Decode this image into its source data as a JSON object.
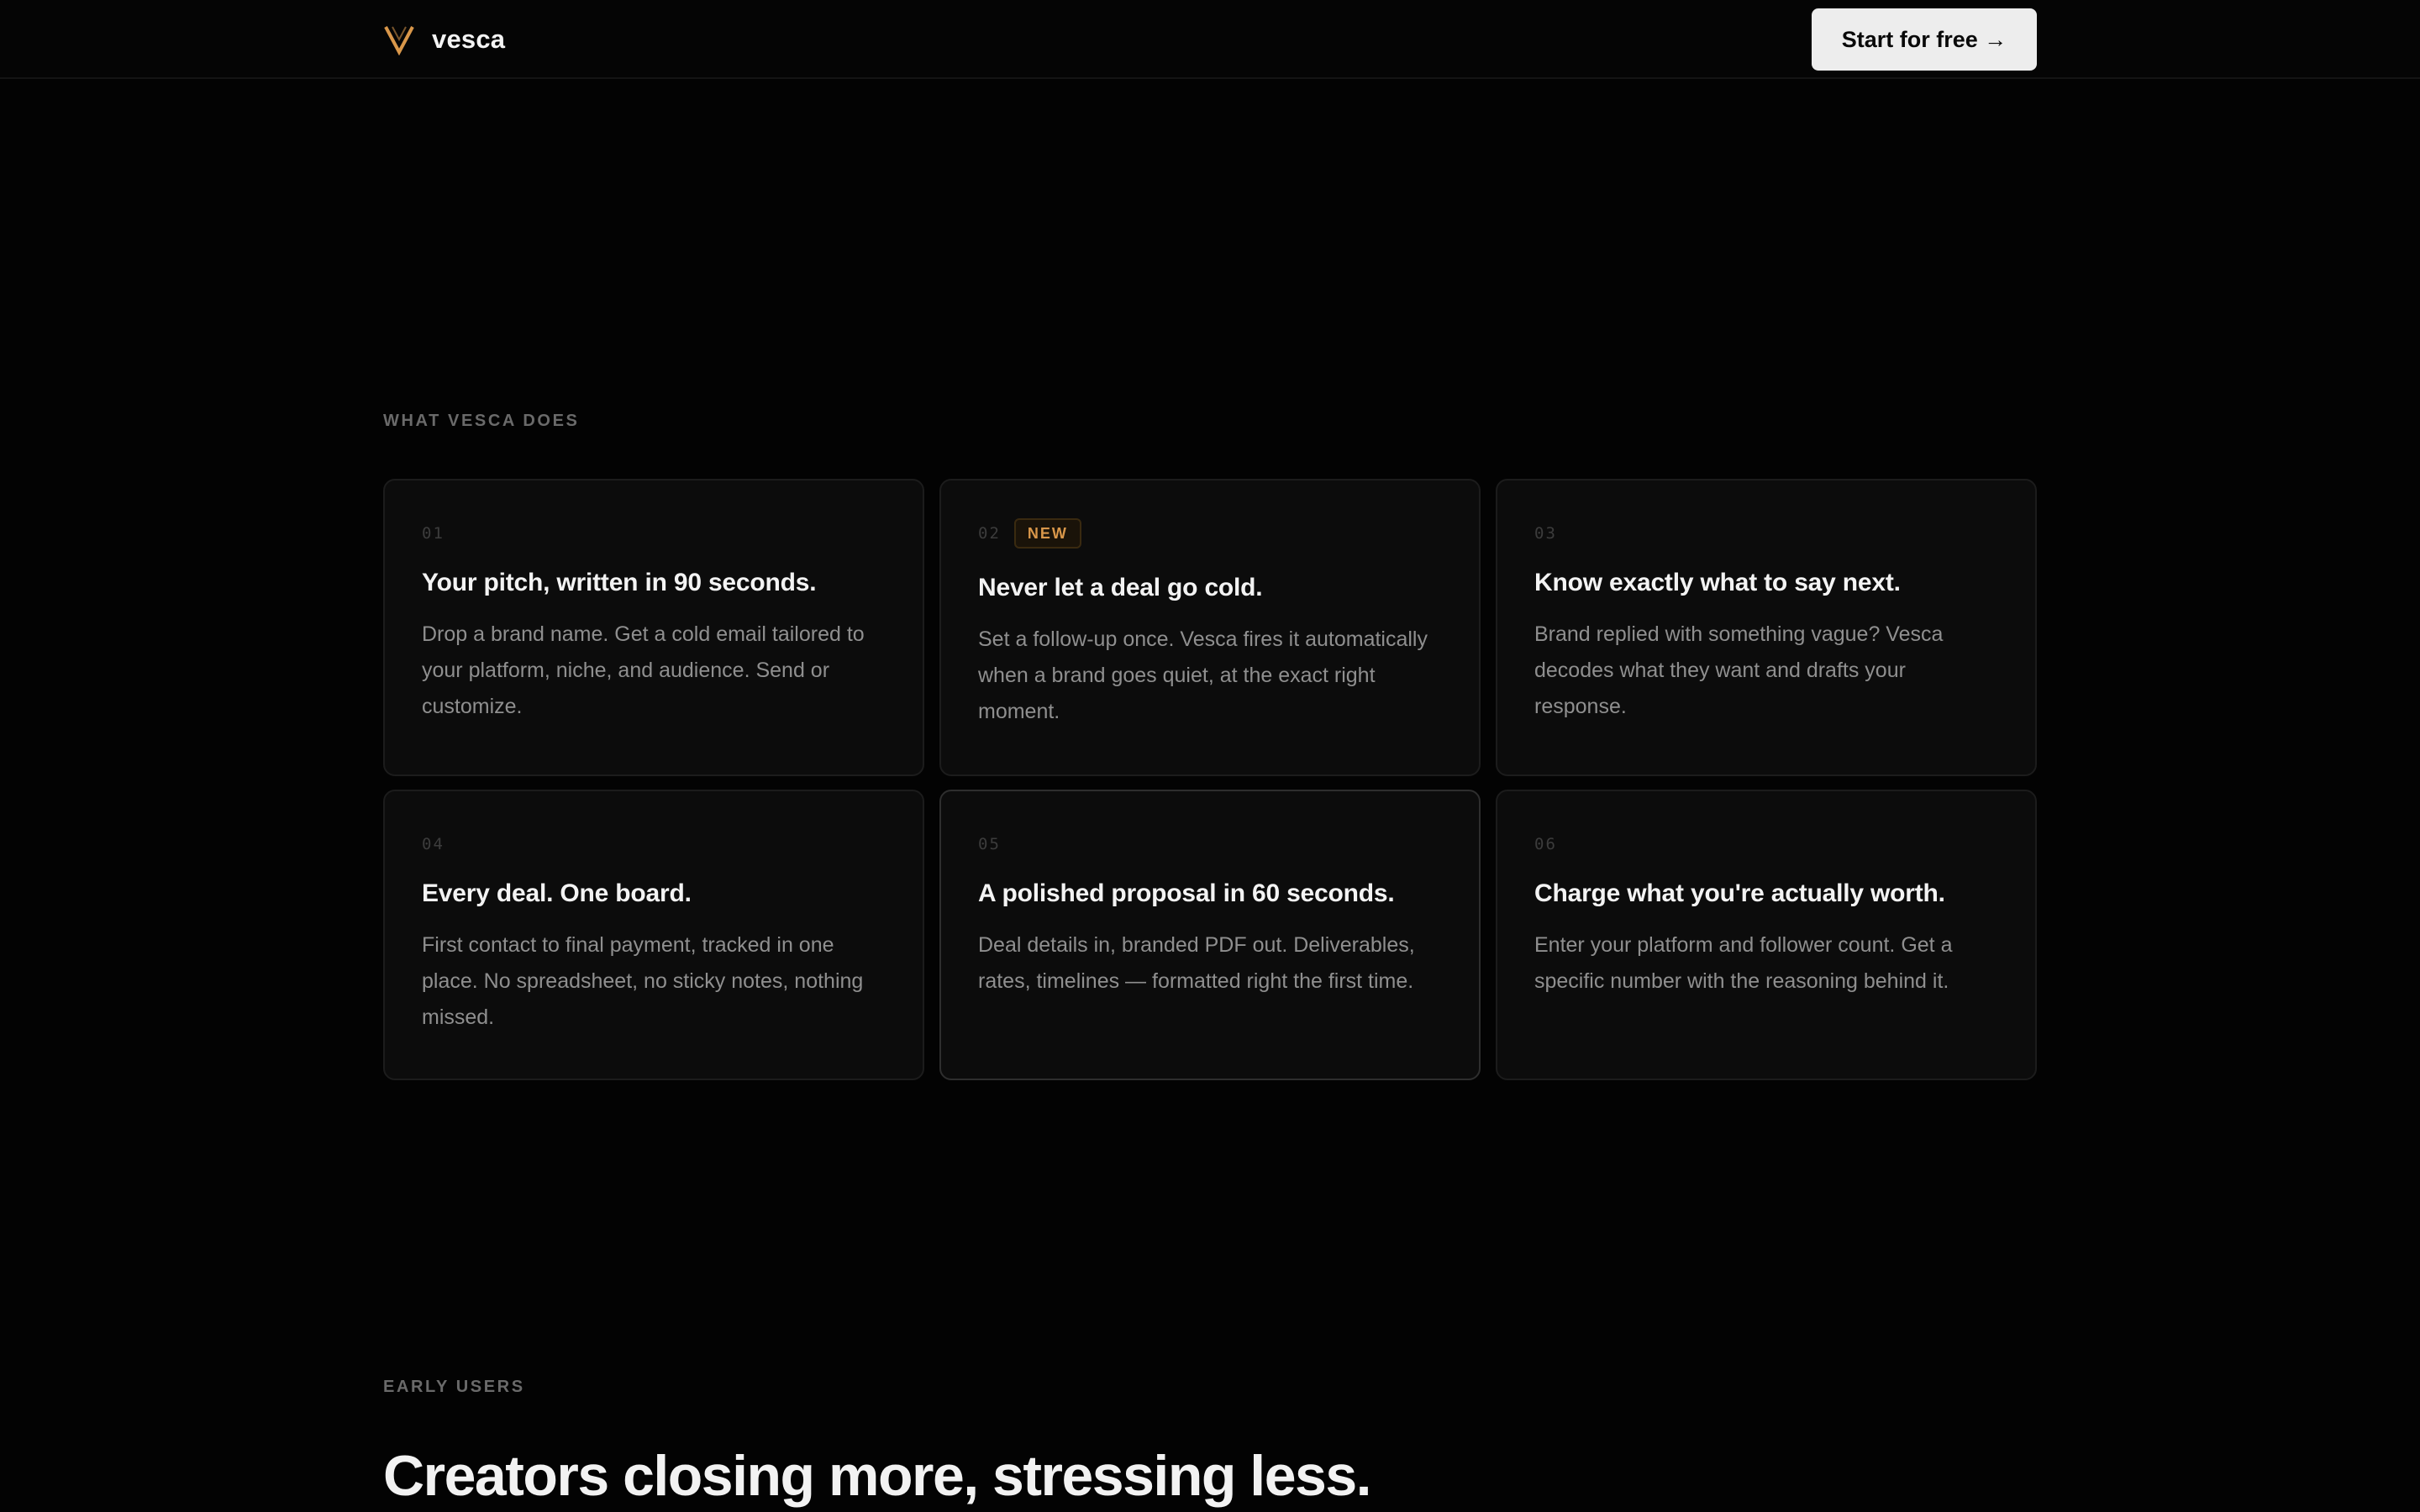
{
  "header": {
    "brand_name": "vesca",
    "logo_icon": "v-chevron-logo-icon",
    "cta_label": "Start for free →"
  },
  "colors": {
    "background": "#030303",
    "accent": "#d9974a",
    "card_background": "#0c0c0c",
    "cta_background": "#ededed"
  },
  "features": {
    "section_label": "WHAT VESCA DOES",
    "cards": [
      {
        "number": "01",
        "title": "Your pitch, written in 90 seconds.",
        "description": "Drop a brand name. Get a cold email tailored to your platform, niche, and audience. Send or customize."
      },
      {
        "number": "02",
        "badge": "NEW",
        "title": "Never let a deal go cold.",
        "description": "Set a follow-up once. Vesca fires it automatically when a brand goes quiet, at the exact right moment."
      },
      {
        "number": "03",
        "title": "Know exactly what to say next.",
        "description": "Brand replied with something vague? Vesca decodes what they want and drafts your response."
      },
      {
        "number": "04",
        "title": "Every deal. One board.",
        "description": "First contact to final payment, tracked in one place. No spreadsheet, no sticky notes, nothing missed."
      },
      {
        "number": "05",
        "title": "A polished proposal in 60 seconds.",
        "description": "Deal details in, branded PDF out. Deliverables, rates, timelines — formatted right the first time."
      },
      {
        "number": "06",
        "title": "Charge what you're actually worth.",
        "description": "Enter your platform and follower count. Get a specific number with the reasoning behind it."
      }
    ]
  },
  "early_users": {
    "section_label": "EARLY USERS",
    "heading": "Creators closing more, stressing less."
  }
}
